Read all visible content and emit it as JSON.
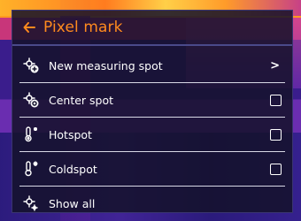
{
  "header": {
    "title": "Pixel mark",
    "back_icon": "arrow-left-icon"
  },
  "colors": {
    "accent": "#ff8a1e",
    "text": "#ffffff"
  },
  "menu": {
    "items": [
      {
        "label": "New measuring spot",
        "icon": "crosshair-plus-icon",
        "control": "chevron"
      },
      {
        "label": "Center spot",
        "icon": "crosshair-center-icon",
        "control": "checkbox",
        "checked": false
      },
      {
        "label": "Hotspot",
        "icon": "thermometer-hot-icon",
        "control": "checkbox",
        "checked": false
      },
      {
        "label": "Coldspot",
        "icon": "thermometer-cold-icon",
        "control": "checkbox",
        "checked": false
      },
      {
        "label": "Show all",
        "icon": "crosshair-multi-icon",
        "control": "none"
      }
    ],
    "chevron_glyph": ">"
  }
}
